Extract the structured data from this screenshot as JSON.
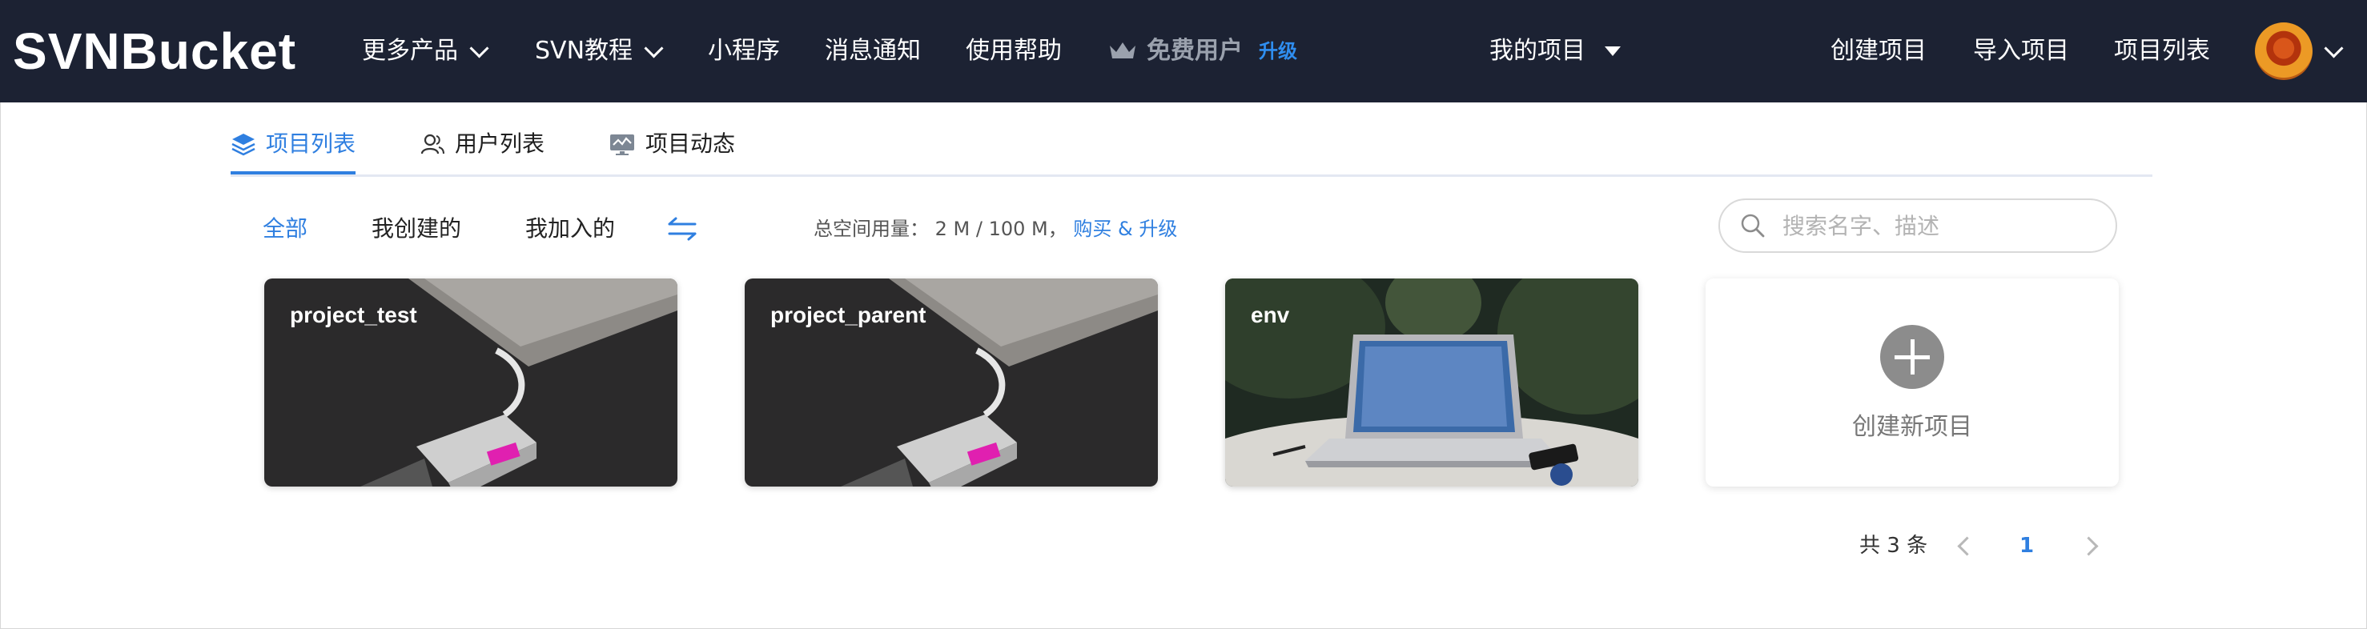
{
  "navbar": {
    "logo": "SVNBucket",
    "items": [
      {
        "label": "更多产品",
        "has_chevron": true
      },
      {
        "label": "SVN教程",
        "has_chevron": true
      },
      {
        "label": "小程序"
      },
      {
        "label": "消息通知"
      },
      {
        "label": "使用帮助"
      }
    ],
    "free_user": "免费用户",
    "upgrade": "升级",
    "my_projects": "我的项目",
    "right_links": [
      "创建项目",
      "导入项目",
      "项目列表"
    ],
    "icons": {
      "crown": "crown-icon",
      "avatar": "avatar",
      "dropdown": "chevron-down-icon"
    }
  },
  "tabs": [
    {
      "label": "项目列表",
      "icon": "layers-icon",
      "active": true
    },
    {
      "label": "用户列表",
      "icon": "users-icon"
    },
    {
      "label": "项目动态",
      "icon": "activity-icon"
    }
  ],
  "filters": {
    "options": [
      "全部",
      "我创建的",
      "我加入的"
    ],
    "active": "全部",
    "swap_icon": "swap-icon"
  },
  "usage": {
    "label": "总空间用量：",
    "value": "2 M / 100 M，",
    "link": "购买 & 升级"
  },
  "search": {
    "placeholder": "搜索名字、描述",
    "value": ""
  },
  "projects": [
    {
      "name": "project_test"
    },
    {
      "name": "project_parent"
    },
    {
      "name": "env"
    }
  ],
  "new_project": {
    "label": "创建新项目"
  },
  "pagination": {
    "total": "共 3 条",
    "current": "1"
  },
  "colors": {
    "navbar_bg": "#1c2233",
    "accent": "#2f7fe0",
    "upgrade": "#2f8ef0"
  }
}
